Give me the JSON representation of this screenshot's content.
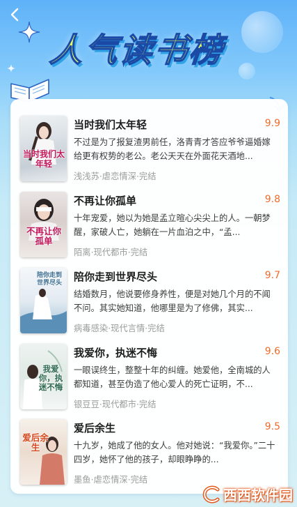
{
  "header": {
    "title": "人气读书榜",
    "back_icon": "chevron-left-icon"
  },
  "colors": {
    "score": "#f06b2c",
    "title_fill": "#e6ff62",
    "title_stroke": "#1b4aa6",
    "meta": "#9b9b9b"
  },
  "books": [
    {
      "cover_text": "当时我们太年轻",
      "title": "当时我们太年轻",
      "score": "9.9",
      "desc": "不过是为了报复渣男前任，洛青青才答应爷爷逼婚嫁给更有权势的老公。老公天天在外面花天酒地...",
      "meta": "浅浅苏·虐恋情深·完结"
    },
    {
      "cover_text": "不再让你孤单",
      "title": "不再让你孤单",
      "score": "9.8",
      "desc": "十年宠爱，她以为她是孟立暄心尖尖上的人。一朝梦醒，家破人亡，她躺在一片血泊之中，“孟...",
      "meta": "陌离·现代都市·完结"
    },
    {
      "cover_text": "陪你走到世界尽头",
      "title": "陪你走到世界尽头",
      "score": "9.7",
      "desc": "结婚数月，他说要修身养性，便是对她几个月的不闻不问。其实她知道，他哪里是为了修佛，其实...",
      "meta": "病毒感染·现代言情·完结"
    },
    {
      "cover_text": "我爱你，执迷不悔",
      "title": "我爱你，执迷不悔",
      "score": "9.6",
      "desc": "一眼误终生，整整十年的纠缠。她爱他，全南城的人都知道，甚至伪造了他心爱人的死亡证明，不...",
      "meta": "银豆豆·现代都市·完结"
    },
    {
      "cover_text": "爱后余生",
      "title": "爱后余生",
      "score": "9.5",
      "desc": "十九岁，她成了他的女人。他对她说：“我爱你。”二十四岁，她怀了他的孩子，却眼睁睁的...",
      "meta": "墨鱼·虐恋情深·完结"
    }
  ],
  "watermark": {
    "text": "西西软件园"
  }
}
